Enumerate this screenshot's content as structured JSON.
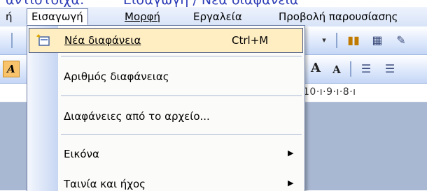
{
  "caption": {
    "left_text": "αντίστοιχα:",
    "right_text": "Εισαγωγή / Νέα διαφάνεια"
  },
  "menubar": {
    "items": [
      {
        "label": "ή"
      },
      {
        "label": "Εισαγωγή"
      },
      {
        "label": "Μορφή"
      },
      {
        "label": "Εργαλεία"
      },
      {
        "label": "Προβολή παρουσίασης"
      }
    ]
  },
  "toolbar": {
    "left_letter": "A",
    "font_grow": "A",
    "font_shrink": "A"
  },
  "ruler": {
    "text": "10·ı·9·ı·8·ı"
  },
  "menu": {
    "items": [
      {
        "label": "Νέα διαφάνεια",
        "shortcut": "Ctrl+M",
        "icon": "new-slide-icon",
        "highlighted": true
      },
      {
        "label": "Αριθμός διαφάνειας"
      },
      {
        "label": "Διαφάνειες από το αρχείο..."
      },
      {
        "label": "Εικόνα",
        "submenu": true
      },
      {
        "label": "Ταινία και ήχος",
        "submenu": true
      }
    ]
  },
  "colors": {
    "highlight": "#ffeec2",
    "menu_border": "#6d7fa6",
    "caption": "#2b3bb5"
  }
}
